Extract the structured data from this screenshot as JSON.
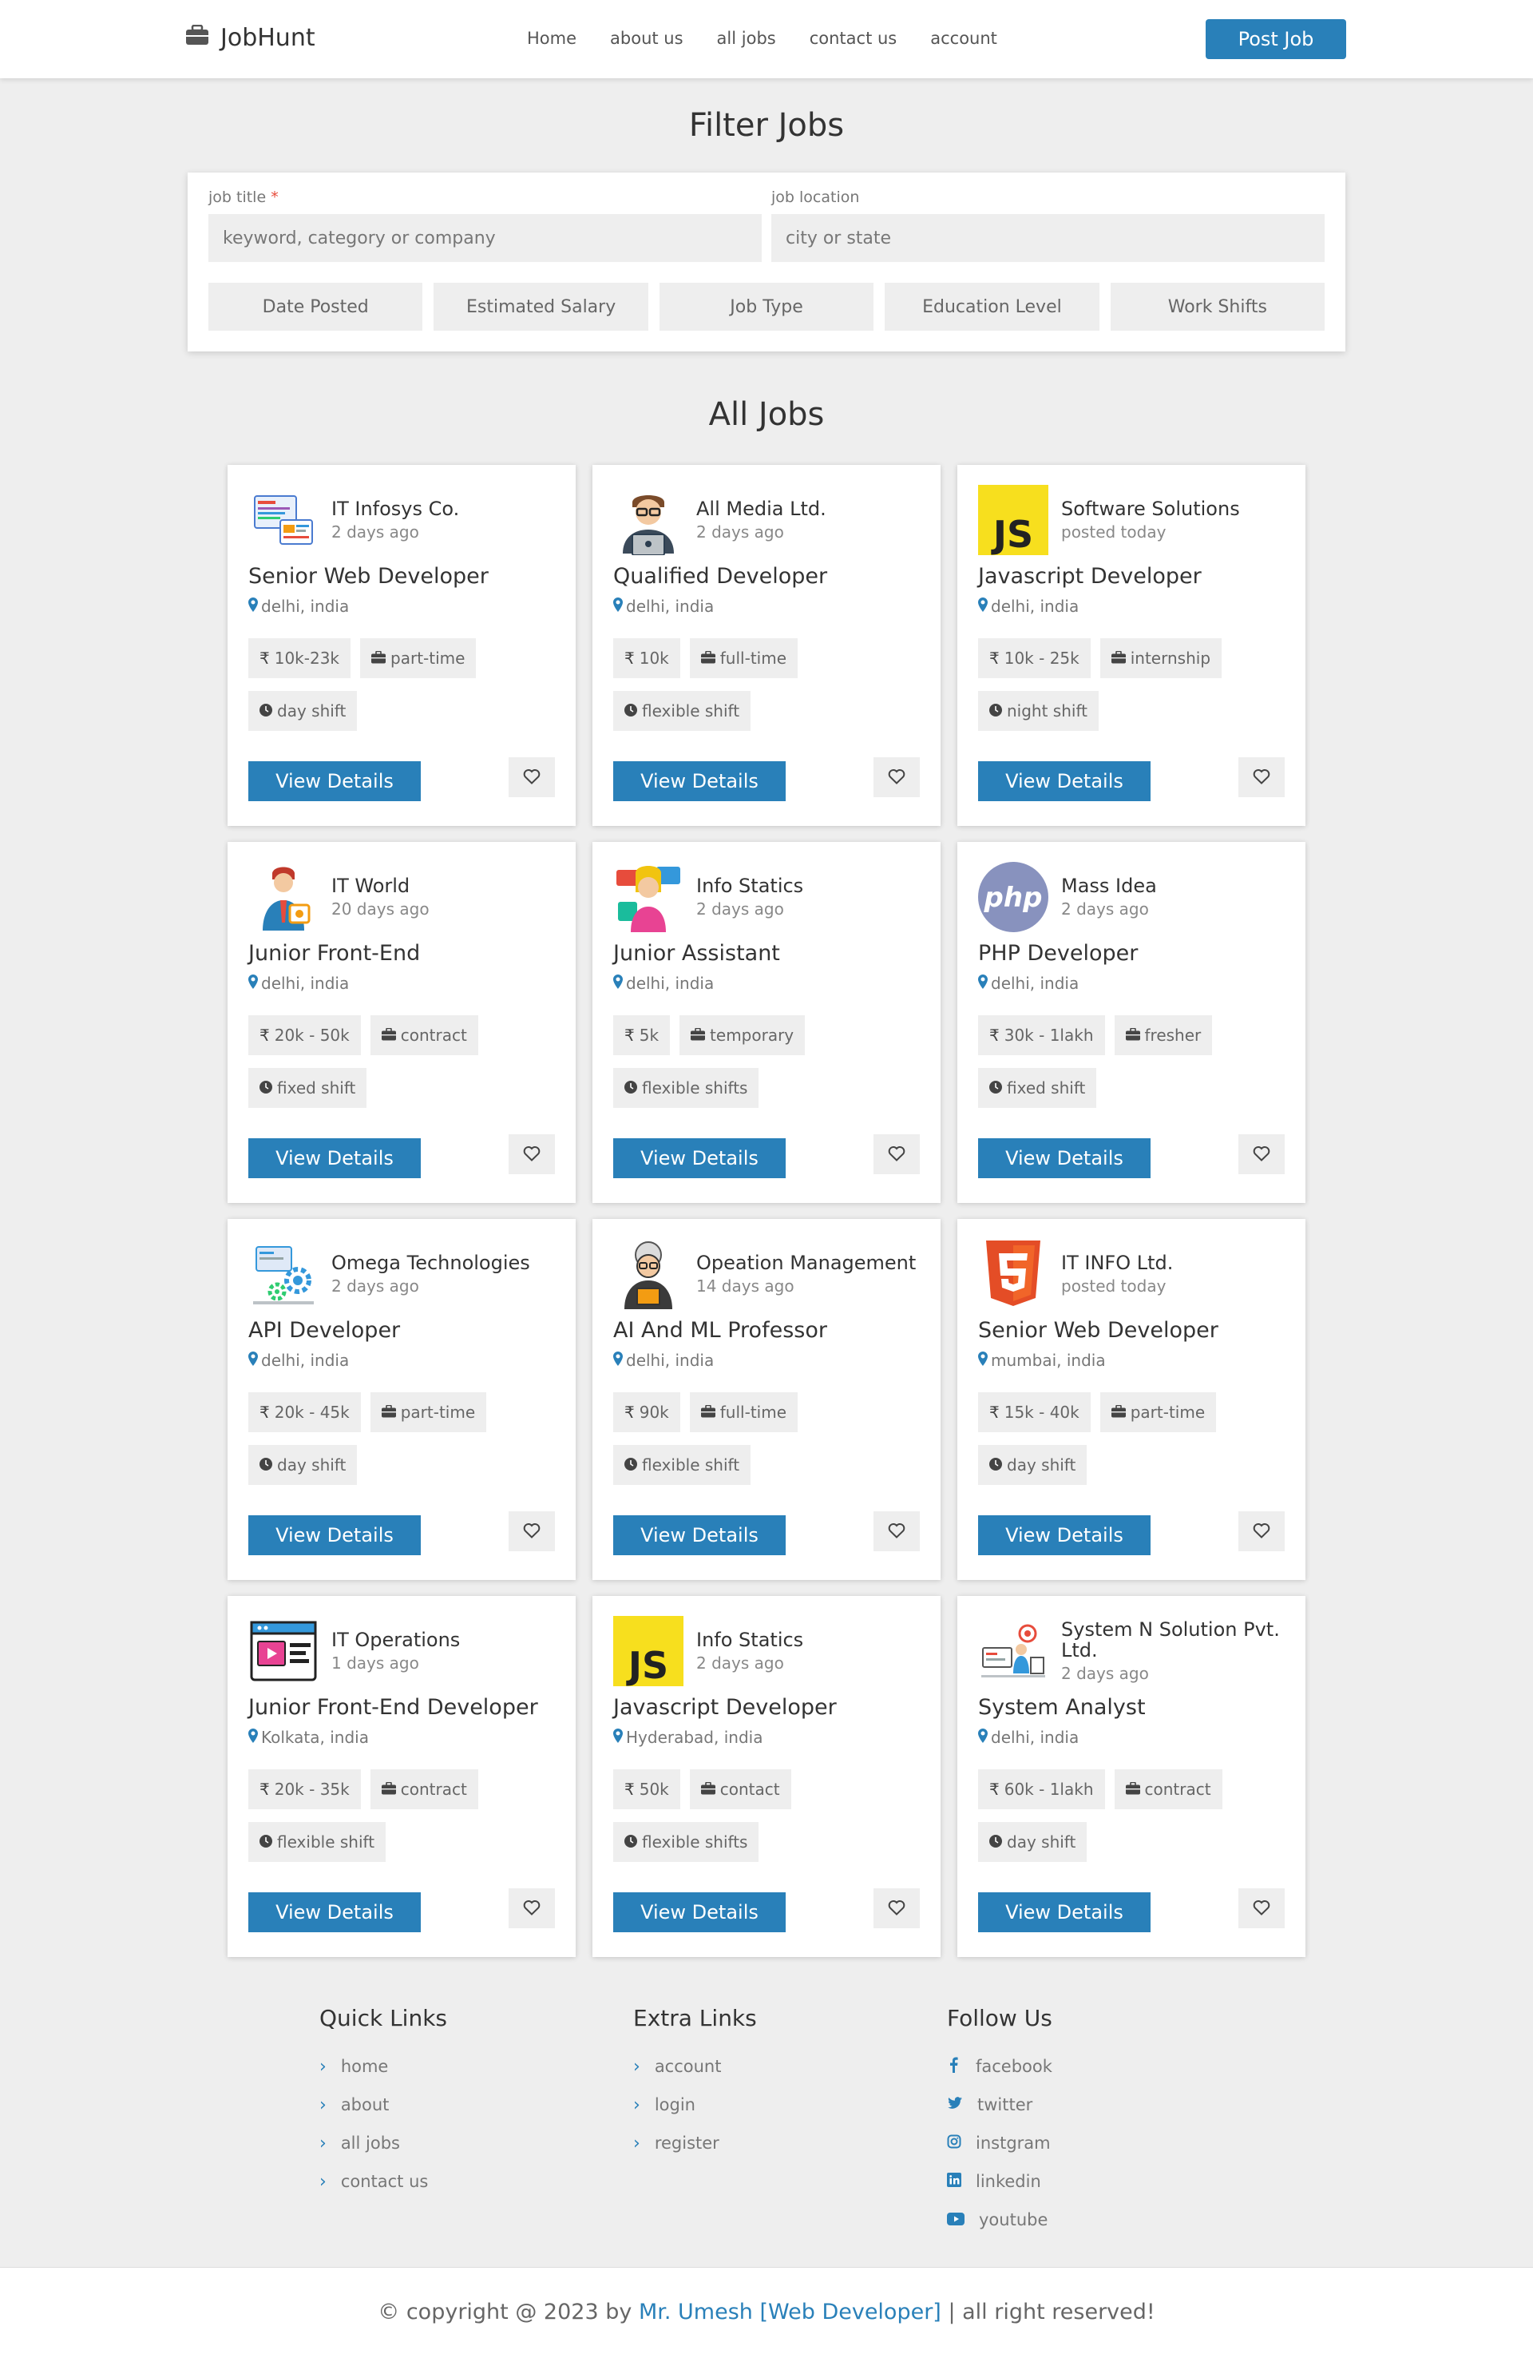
{
  "header": {
    "logo": "JobHunt",
    "nav": [
      "Home",
      "about us",
      "all jobs",
      "contact us",
      "account"
    ],
    "post_job": "Post Job"
  },
  "filter": {
    "title": "Filter Jobs",
    "job_title_label": "job title",
    "job_title_placeholder": "keyword, category or company",
    "job_location_label": "job location",
    "job_location_placeholder": "city or state",
    "buttons": [
      "Date Posted",
      "Estimated Salary",
      "Job Type",
      "Education Level",
      "Work Shifts"
    ]
  },
  "jobs_title": "All Jobs",
  "view_details": "View Details",
  "jobs": [
    {
      "company": "IT Infosys Co.",
      "posted": "2 days ago",
      "title": "Senior Web Developer",
      "location": "delhi, india",
      "salary": "10k-23k",
      "type": "part-time",
      "shift": "day shift",
      "logo": "web-dev-illustration-icon"
    },
    {
      "company": "All Media Ltd.",
      "posted": "2 days ago",
      "title": "Qualified Developer",
      "location": "delhi, india",
      "salary": "10k",
      "type": "full-time",
      "shift": "flexible shift",
      "logo": "programmer-avatar-icon"
    },
    {
      "company": "Software Solutions",
      "posted": "posted today",
      "title": "Javascript Developer",
      "location": "delhi, india",
      "salary": "10k - 25k",
      "type": "internship",
      "shift": "night shift",
      "logo": "js-icon"
    },
    {
      "company": "IT World",
      "posted": "20 days ago",
      "title": "Junior Front-End",
      "location": "delhi, india",
      "salary": "20k - 50k",
      "type": "contract",
      "shift": "fixed shift",
      "logo": "businessman-icon"
    },
    {
      "company": "Info Statics",
      "posted": "2 days ago",
      "title": "Junior Assistant",
      "location": "delhi, india",
      "salary": "5k",
      "type": "temporary",
      "shift": "flexible shifts",
      "logo": "assistant-icon"
    },
    {
      "company": "Mass Idea",
      "posted": "2 days ago",
      "title": "PHP Developer",
      "location": "delhi, india",
      "salary": "30k - 1lakh",
      "type": "fresher",
      "shift": "fixed shift",
      "logo": "php-icon",
      "logo_text": "php"
    },
    {
      "company": "Omega Technologies",
      "posted": "2 days ago",
      "title": "API Developer",
      "location": "delhi, india",
      "salary": "20k - 45k",
      "type": "part-time",
      "shift": "day shift",
      "logo": "api-gears-icon"
    },
    {
      "company": "Opeation Management",
      "posted": "14 days ago",
      "title": "AI And ML Professor",
      "location": "delhi, india",
      "salary": "90k",
      "type": "full-time",
      "shift": "flexible shift",
      "logo": "professor-icon"
    },
    {
      "company": "IT INFO Ltd.",
      "posted": "posted today",
      "title": "Senior Web Developer",
      "location": "mumbai, india",
      "salary": "15k - 40k",
      "type": "part-time",
      "shift": "day shift",
      "logo": "html5-icon"
    },
    {
      "company": "IT Operations",
      "posted": "1 days ago",
      "title": "Junior Front-End Developer",
      "location": "Kolkata, india",
      "salary": "20k - 35k",
      "type": "contract",
      "shift": "flexible shift",
      "logo": "browser-window-icon"
    },
    {
      "company": "Info Statics",
      "posted": "2 days ago",
      "title": "Javascript Developer",
      "location": "Hyderabad, india",
      "salary": "50k",
      "type": "contact",
      "shift": "flexible shifts",
      "logo": "js-icon"
    },
    {
      "company": "System N Solution Pvt. Ltd.",
      "posted": "2 days ago",
      "title": "System Analyst",
      "location": "delhi, india",
      "salary": "60k - 1lakh",
      "type": "contract",
      "shift": "day shift",
      "logo": "analyst-illustration-icon"
    }
  ],
  "footer": {
    "quick_links_title": "Quick Links",
    "quick_links": [
      "home",
      "about",
      "all jobs",
      "contact us"
    ],
    "extra_links_title": "Extra Links",
    "extra_links": [
      "account",
      "login",
      "register"
    ],
    "follow_title": "Follow Us",
    "follow": [
      {
        "label": "facebook",
        "icon": "facebook-icon"
      },
      {
        "label": "twitter",
        "icon": "twitter-icon"
      },
      {
        "label": "instgram",
        "icon": "instagram-icon"
      },
      {
        "label": "linkedin",
        "icon": "linkedin-icon"
      },
      {
        "label": "youtube",
        "icon": "youtube-icon"
      }
    ]
  },
  "copyright": {
    "prefix": "© copyright @ 2023 by",
    "author": "Mr. Umesh [Web Developer]",
    "suffix": "| all right reserved!"
  },
  "colors": {
    "accent": "#2980b9",
    "js_yellow": "#f7df1e",
    "php_purple": "#8892be",
    "html5_orange": "#e44d26",
    "background": "#eeeeee"
  }
}
